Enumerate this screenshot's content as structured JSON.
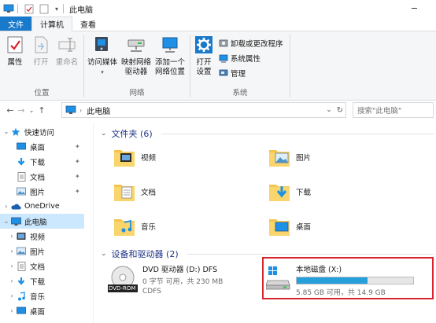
{
  "window": {
    "title": "此电脑"
  },
  "ribbon_tabs": [
    {
      "label": "文件",
      "kind": "file"
    },
    {
      "label": "计算机",
      "kind": "active"
    },
    {
      "label": "查看",
      "kind": "normal"
    }
  ],
  "ribbon": {
    "location": {
      "label": "位置",
      "properties": "属性",
      "open": "打开",
      "rename": "重命名"
    },
    "network": {
      "label": "网络",
      "media_access": "访问媒体",
      "map_drive_l1": "映射网络",
      "map_drive_l2": "驱动器",
      "add_location_l1": "添加一个",
      "add_location_l2": "网络位置"
    },
    "system": {
      "label": "系统",
      "open_settings_l1": "打开",
      "open_settings_l2": "设置",
      "uninstall": "卸载或更改程序",
      "system_properties": "系统属性",
      "manage": "管理"
    }
  },
  "addressbar": {
    "breadcrumb": "此电脑",
    "search_placeholder": "搜索\"此电脑\""
  },
  "navpane": {
    "items": [
      {
        "label": "快速访问",
        "icon": "star-icon",
        "chevron": "expanded",
        "pinned": false,
        "indent": 0
      },
      {
        "label": "桌面",
        "icon": "desktop-icon",
        "chevron": "none",
        "pinned": true,
        "indent": 1
      },
      {
        "label": "下载",
        "icon": "download-icon",
        "chevron": "none",
        "pinned": true,
        "indent": 1
      },
      {
        "label": "文档",
        "icon": "document-icon",
        "chevron": "none",
        "pinned": true,
        "indent": 1
      },
      {
        "label": "图片",
        "icon": "pictures-icon",
        "chevron": "none",
        "pinned": true,
        "indent": 1
      },
      {
        "label": "OneDrive",
        "icon": "onedrive-icon",
        "chevron": "collapsed",
        "pinned": false,
        "indent": 0
      },
      {
        "label": "此电脑",
        "icon": "computer-icon",
        "chevron": "expanded",
        "pinned": false,
        "indent": 0,
        "selected": true
      },
      {
        "label": "视频",
        "icon": "videos-icon",
        "chevron": "collapsed",
        "pinned": false,
        "indent": 1
      },
      {
        "label": "图片",
        "icon": "pictures-icon",
        "chevron": "collapsed",
        "pinned": false,
        "indent": 1
      },
      {
        "label": "文档",
        "icon": "document-icon",
        "chevron": "collapsed",
        "pinned": false,
        "indent": 1
      },
      {
        "label": "下载",
        "icon": "download-icon",
        "chevron": "collapsed",
        "pinned": false,
        "indent": 1
      },
      {
        "label": "音乐",
        "icon": "music-icon",
        "chevron": "collapsed",
        "pinned": false,
        "indent": 1
      },
      {
        "label": "桌面",
        "icon": "desktop-icon",
        "chevron": "collapsed",
        "pinned": false,
        "indent": 1
      }
    ]
  },
  "content": {
    "folders_header": "文件夹 (6)",
    "folders": [
      {
        "label": "视频",
        "icon": "videos-folder-icon"
      },
      {
        "label": "图片",
        "icon": "pictures-folder-icon"
      },
      {
        "label": "文档",
        "icon": "documents-folder-icon"
      },
      {
        "label": "下载",
        "icon": "downloads-folder-icon"
      },
      {
        "label": "音乐",
        "icon": "music-folder-icon"
      },
      {
        "label": "桌面",
        "icon": "desktop-folder-icon"
      }
    ],
    "drives_header": "设备和驱动器 (2)",
    "dvd": {
      "name": "DVD 驱动器 (D:) DFS",
      "usage": "0 字节 可用，共 230 MB",
      "filesystem": "CDFS",
      "badge": "DVD-ROM"
    },
    "local_disk": {
      "name": "本地磁盘 (X:)",
      "usage": "5.85 GB 可用，共 14.9 GB",
      "used_fraction": 0.61
    }
  },
  "colors": {
    "accent": "#1979ca",
    "selection": "#cce8ff",
    "highlight_border": "#d9252d",
    "capacity_bar": "#26a0da",
    "folder": "#f4c44d"
  }
}
